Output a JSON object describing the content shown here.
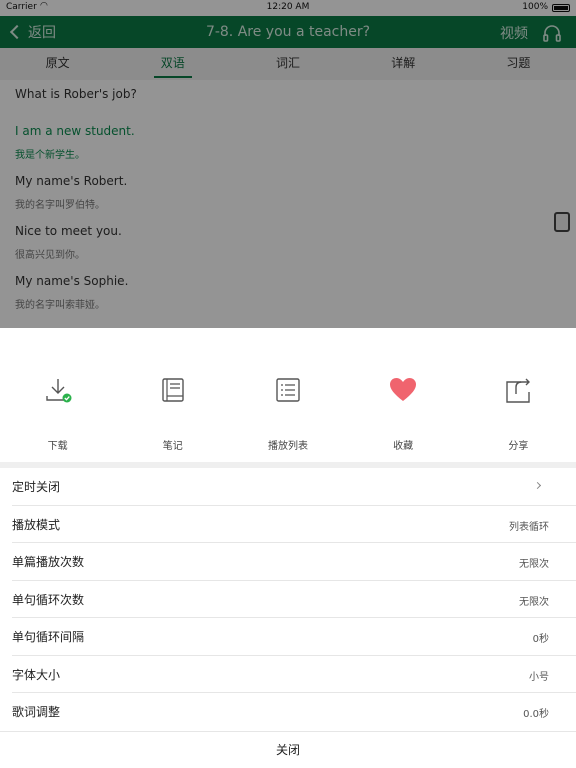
{
  "status_bar": {
    "carrier": "Carrier",
    "time": "12:20 AM",
    "battery": "100%"
  },
  "nav": {
    "back_label": "返回",
    "title": "7-8.  Are you a teacher?",
    "video_label": "视频"
  },
  "tabs": [
    {
      "label": "原文"
    },
    {
      "label": "双语"
    },
    {
      "label": "词汇"
    },
    {
      "label": "详解"
    },
    {
      "label": "习题"
    }
  ],
  "content": {
    "lines": [
      {
        "en": "What is Rober's job?"
      },
      {
        "en": "I am a new student.",
        "zh": "我是个新学生。"
      },
      {
        "en": "My name's Robert.",
        "zh": "我的名字叫罗伯特。"
      },
      {
        "en": "Nice to meet you.",
        "zh": "很高兴见到你。"
      },
      {
        "en": "My name's Sophie.",
        "zh": "我的名字叫索菲娅。"
      }
    ]
  },
  "actions": [
    {
      "label": "下载",
      "icon": "download-icon"
    },
    {
      "label": "笔记",
      "icon": "notebook-icon"
    },
    {
      "label": "播放列表",
      "icon": "playlist-icon"
    },
    {
      "label": "收藏",
      "icon": "heart-icon"
    },
    {
      "label": "分享",
      "icon": "share-icon"
    }
  ],
  "settings": [
    {
      "label": "定时关闭",
      "value": ""
    },
    {
      "label": "播放模式",
      "value": "列表循环"
    },
    {
      "label": "单篇播放次数",
      "value": "无限次"
    },
    {
      "label": "单句循环次数",
      "value": "无限次"
    },
    {
      "label": "单句循环间隔",
      "value": "0秒"
    },
    {
      "label": "字体大小",
      "value": "小号"
    },
    {
      "label": "歌词调整",
      "value": "0.0秒"
    }
  ],
  "close_label": "关闭",
  "colors": {
    "brand_green": "#0c7a46",
    "heart": "#f0646e",
    "check": "#2bb24c"
  }
}
